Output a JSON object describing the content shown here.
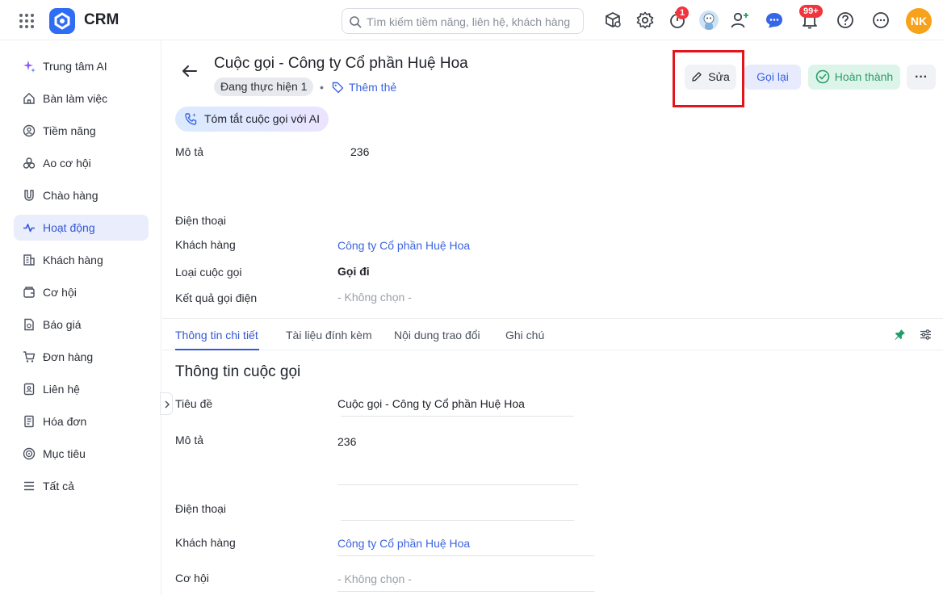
{
  "app": {
    "title": "CRM",
    "avatar_initials": "NK"
  },
  "search": {
    "placeholder": "Tìm kiếm tiềm năng, liên hệ, khách hàng"
  },
  "topbar": {
    "timer_badge": "1",
    "notification_badge": "99+"
  },
  "sidebar": {
    "items": [
      {
        "label": "Trung tâm AI",
        "icon": "sparkle-icon"
      },
      {
        "label": "Bàn làm việc",
        "icon": "home-icon"
      },
      {
        "label": "Tiềm năng",
        "icon": "user-circle-icon"
      },
      {
        "label": "Ao cơ hội",
        "icon": "pool-icon"
      },
      {
        "label": "Chào hàng",
        "icon": "magnet-icon"
      },
      {
        "label": "Hoạt động",
        "icon": "activity-icon"
      },
      {
        "label": "Khách hàng",
        "icon": "building-icon"
      },
      {
        "label": "Cơ hội",
        "icon": "wallet-icon"
      },
      {
        "label": "Báo giá",
        "icon": "quote-icon"
      },
      {
        "label": "Đơn hàng",
        "icon": "cart-icon"
      },
      {
        "label": "Liên hệ",
        "icon": "contact-icon"
      },
      {
        "label": "Hóa đơn",
        "icon": "invoice-icon"
      },
      {
        "label": "Mục tiêu",
        "icon": "target-icon"
      },
      {
        "label": "Tất cả",
        "icon": "menu-icon"
      }
    ],
    "active_index": 5
  },
  "header": {
    "title": "Cuộc gọi - Công ty Cổ phần Huệ Hoa",
    "status": "Đang thực hiện 1",
    "separator": "•",
    "add_tag": "Thêm thẻ",
    "edit_label": "Sửa",
    "call_again_label": "Gọi lại",
    "complete_label": "Hoàn thành",
    "more_label": "···"
  },
  "ai_summary": {
    "label": "Tóm tắt cuộc gọi với AI"
  },
  "summary": {
    "description_label": "Mô tả",
    "description_value": "236",
    "phone_label": "Điện thoại",
    "customer_label": "Khách hàng",
    "customer_value": "Công ty Cổ phần Huệ Hoa",
    "call_type_label": "Loại cuộc gọi",
    "call_type_value": "Gọi đi",
    "call_result_label": "Kết quả gọi điện",
    "call_result_value": "- Không chọn -"
  },
  "tabs": [
    {
      "label": "Thông tin chi tiết"
    },
    {
      "label": "Tài liệu đính kèm"
    },
    {
      "label": "Nội dung trao đổi"
    },
    {
      "label": "Ghi chú"
    }
  ],
  "detail": {
    "section_title": "Thông tin cuộc gọi",
    "title_label": "Tiêu đề",
    "title_value": "Cuộc gọi - Công ty Cổ phần Huệ Hoa",
    "description_label": "Mô tả",
    "description_value": "236",
    "phone_label": "Điện thoại",
    "customer_label": "Khách hàng",
    "customer_value": "Công ty Cổ phần Huệ Hoa",
    "opportunity_label": "Cơ hội",
    "opportunity_value": "- Không chọn -"
  }
}
